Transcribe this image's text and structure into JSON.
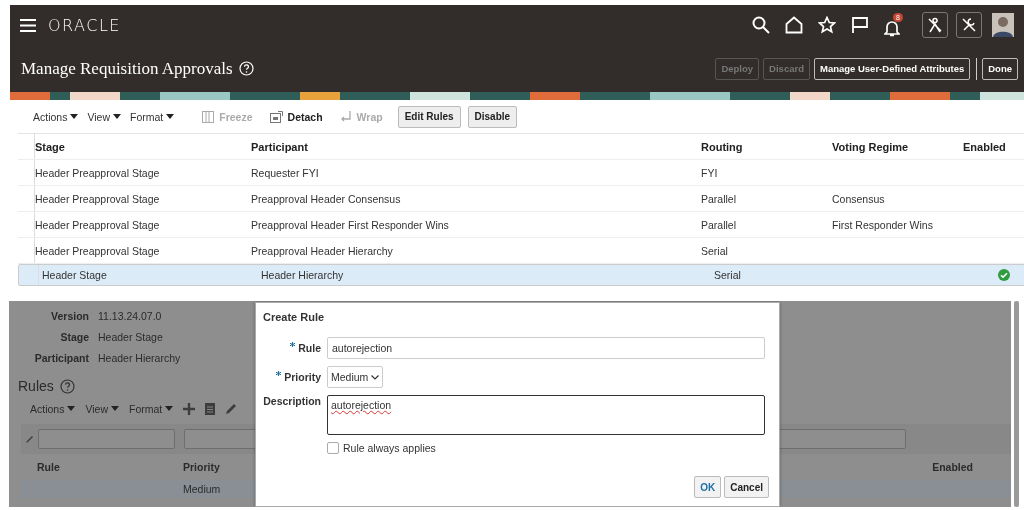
{
  "header": {
    "logo": "ORACLE",
    "notification_count": "8"
  },
  "page": {
    "title": "Manage Requisition Approvals",
    "buttons": [
      {
        "label": "Deploy",
        "disabled": true
      },
      {
        "label": "Discard",
        "disabled": true
      },
      {
        "label": "Manage User-Defined Attributes",
        "disabled": false
      },
      {
        "label": "Done",
        "disabled": false
      }
    ]
  },
  "toolbar": {
    "menus": [
      "Actions",
      "View",
      "Format"
    ],
    "tools": [
      {
        "kind": "freeze",
        "label": "Freeze",
        "disabled": true
      },
      {
        "kind": "detach",
        "label": "Detach",
        "disabled": false
      },
      {
        "kind": "wrap",
        "label": "Wrap",
        "disabled": true
      }
    ],
    "buttons": [
      "Edit Rules",
      "Disable"
    ]
  },
  "table": {
    "columns": [
      "Stage",
      "Participant",
      "Routing",
      "Voting Regime",
      "Enabled"
    ],
    "rows": [
      {
        "cells": [
          "Header Preapproval Stage",
          "Requester FYI",
          "FYI",
          ""
        ],
        "enabled": false,
        "selected": false
      },
      {
        "cells": [
          "Header Preapproval Stage",
          "Preapproval Header Consensus",
          "Parallel",
          "Consensus"
        ],
        "enabled": false,
        "selected": false
      },
      {
        "cells": [
          "Header Preapproval Stage",
          "Preapproval Header First Responder Wins",
          "Parallel",
          "First Responder Wins"
        ],
        "enabled": false,
        "selected": false
      },
      {
        "cells": [
          "Header Preapproval Stage",
          "Preapproval Header Hierarchy",
          "Serial",
          ""
        ],
        "enabled": false,
        "selected": false
      },
      {
        "cells": [
          "Header Stage",
          "Header Hierarchy",
          "Serial",
          ""
        ],
        "enabled": true,
        "selected": true
      }
    ]
  },
  "details": [
    {
      "label": "Version",
      "value": "11.13.24.07.0"
    },
    {
      "label": "Stage",
      "value": "Header Stage"
    },
    {
      "label": "Participant",
      "value": "Header Hierarchy"
    }
  ],
  "rules": {
    "title": "Rules",
    "menus": [
      "Actions",
      "View",
      "Format"
    ],
    "columns": [
      "Rule",
      "Priority",
      "Enabled"
    ],
    "rows": [
      {
        "priority": "Medium"
      }
    ]
  },
  "dialog": {
    "title": "Create Rule",
    "fields": [
      {
        "kind": "text",
        "label": "Rule",
        "required": true,
        "value": "autorejection"
      },
      {
        "kind": "select",
        "label": "Priority",
        "required": true,
        "value": "Medium"
      },
      {
        "kind": "textarea",
        "label": "Description",
        "required": false,
        "value": "autorejection"
      }
    ],
    "checkbox": {
      "label": "Rule always applies",
      "checked": false
    },
    "buttons": [
      "OK",
      "Cancel"
    ]
  }
}
